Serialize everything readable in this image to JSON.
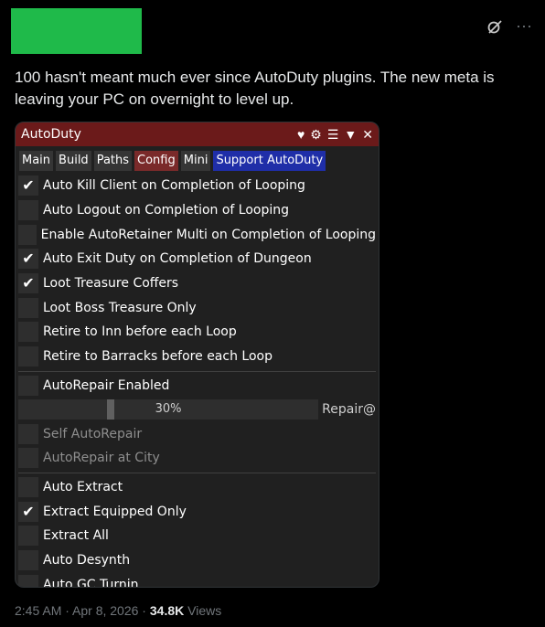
{
  "post": {
    "text": "100 hasn't meant much ever since AutoDuty plugins. The new meta is leaving your PC on overnight to level up.",
    "time": "2:45 AM · Apr 8, 2026 · ",
    "views_count": "34.8K",
    "views_label": " Views",
    "more_label": "···"
  },
  "window": {
    "title": "AutoDuty",
    "tabs": [
      {
        "label": "Main",
        "state": "normal"
      },
      {
        "label": "Build",
        "state": "normal"
      },
      {
        "label": "Paths",
        "state": "normal"
      },
      {
        "label": "Config",
        "state": "active"
      },
      {
        "label": "Mini",
        "state": "normal"
      },
      {
        "label": "Support AutoDuty",
        "state": "support"
      }
    ],
    "group1": [
      {
        "label": "Auto Kill Client on Completion of Looping",
        "checked": true
      },
      {
        "label": "Auto Logout on Completion of Looping",
        "checked": false
      },
      {
        "label": "Enable AutoRetainer Multi on Completion of Looping",
        "checked": false
      },
      {
        "label": "Auto Exit Duty on Completion of Dungeon",
        "checked": true
      },
      {
        "label": "Loot Treasure Coffers",
        "checked": true
      },
      {
        "label": "Loot Boss Treasure Only",
        "checked": false
      },
      {
        "label": "Retire to Inn before each Loop",
        "checked": false
      },
      {
        "label": "Retire to Barracks before each Loop",
        "checked": false
      }
    ],
    "repair": {
      "enabled_label": "AutoRepair Enabled",
      "slider_value": "30%",
      "slider_fraction": 0.3,
      "slider_label": "Repair@",
      "self_label": "Self AutoRepair",
      "city_label": "AutoRepair at City"
    },
    "group3": [
      {
        "label": "Auto Extract",
        "checked": false
      },
      {
        "label": "Extract Equipped Only",
        "checked": true
      },
      {
        "label": "Extract All",
        "checked": false
      },
      {
        "label": "Auto Desynth",
        "checked": false
      },
      {
        "label": "Auto GC Turnin",
        "checked": false
      }
    ]
  }
}
